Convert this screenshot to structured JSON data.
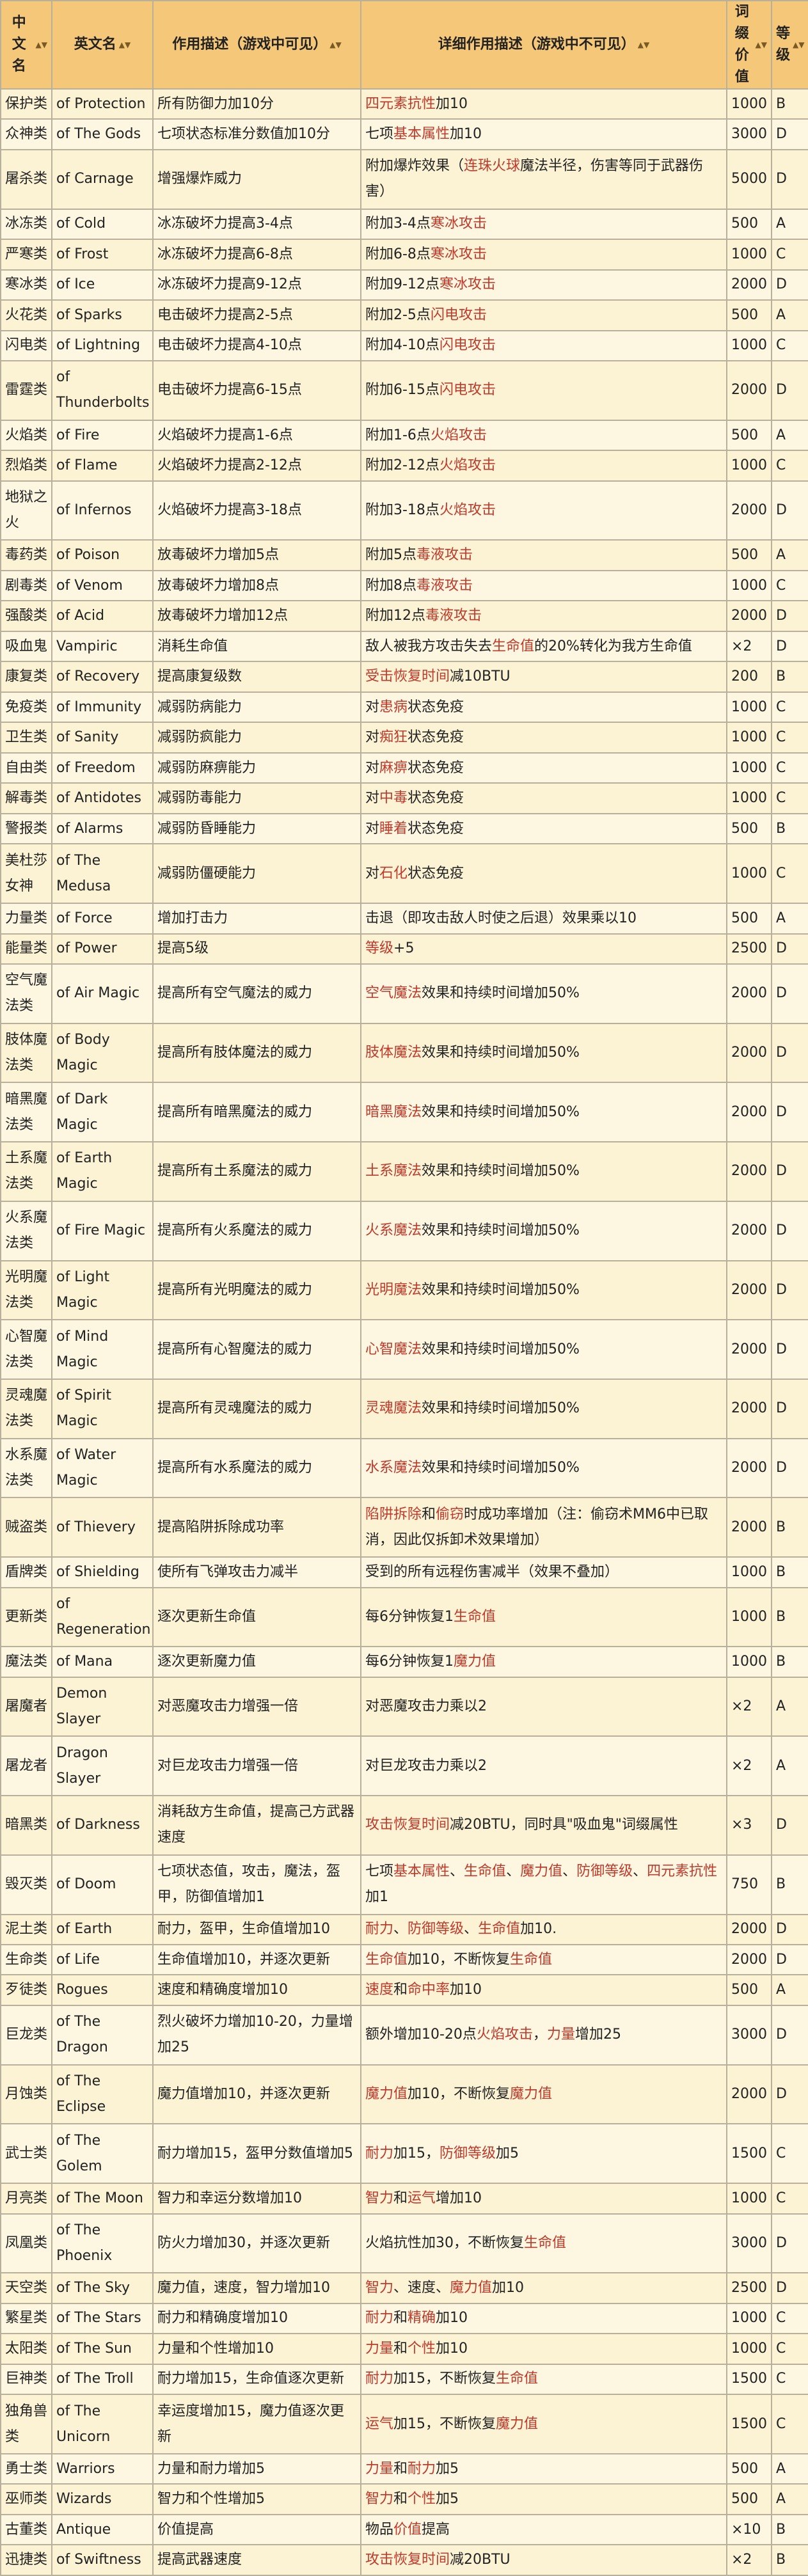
{
  "headers": {
    "cn": "中文名",
    "en": "英文名",
    "use": "作用描述（游戏中可见）",
    "detail": "详细作用描述（游戏中不可见）",
    "value": "词缀价值",
    "level": "等级"
  },
  "rows": [
    {
      "cn": "保护类",
      "en": "of Protection",
      "use": "所有防御力加10分",
      "detail": [
        [
          "四元素抗性",
          1
        ],
        [
          "加10",
          0
        ]
      ],
      "value": "1000",
      "level": "B"
    },
    {
      "cn": "众神类",
      "en": "of The Gods",
      "use": "七项状态标准分数值加10分",
      "detail": [
        [
          "七项",
          0
        ],
        [
          "基本属性",
          1
        ],
        [
          "加10",
          0
        ]
      ],
      "value": "3000",
      "level": "D"
    },
    {
      "cn": "屠杀类",
      "en": "of Carnage",
      "use": "增强爆炸威力",
      "detail": [
        [
          "附加爆炸效果（",
          0
        ],
        [
          "连珠火球",
          1
        ],
        [
          "魔法半径，伤害等同于武器伤害）",
          0
        ]
      ],
      "value": "5000",
      "level": "D"
    },
    {
      "cn": "冰冻类",
      "en": "of Cold",
      "use": "冰冻破坏力提高3-4点",
      "detail": [
        [
          "附加3-4点",
          0
        ],
        [
          "寒冰攻击",
          1
        ]
      ],
      "value": "500",
      "level": "A"
    },
    {
      "cn": "严寒类",
      "en": "of Frost",
      "use": "冰冻破坏力提高6-8点",
      "detail": [
        [
          "附加6-8点",
          0
        ],
        [
          "寒冰攻击",
          1
        ]
      ],
      "value": "1000",
      "level": "C"
    },
    {
      "cn": "寒冰类",
      "en": "of Ice",
      "use": "冰冻破坏力提高9-12点",
      "detail": [
        [
          "附加9-12点",
          0
        ],
        [
          "寒冰攻击",
          1
        ]
      ],
      "value": "2000",
      "level": "D"
    },
    {
      "cn": "火花类",
      "en": "of Sparks",
      "use": "电击破坏力提高2-5点",
      "detail": [
        [
          "附加2-5点",
          0
        ],
        [
          "闪电攻击",
          1
        ]
      ],
      "value": "500",
      "level": "A"
    },
    {
      "cn": "闪电类",
      "en": "of Lightning",
      "use": "电击破坏力提高4-10点",
      "detail": [
        [
          "附加4-10点",
          0
        ],
        [
          "闪电攻击",
          1
        ]
      ],
      "value": "1000",
      "level": "C"
    },
    {
      "cn": "雷霆类",
      "en": "of Thunderbolts",
      "use": "电击破坏力提高6-15点",
      "detail": [
        [
          "附加6-15点",
          0
        ],
        [
          "闪电攻击",
          1
        ]
      ],
      "value": "2000",
      "level": "D"
    },
    {
      "cn": "火焰类",
      "en": "of Fire",
      "use": "火焰破坏力提高1-6点",
      "detail": [
        [
          "附加1-6点",
          0
        ],
        [
          "火焰攻击",
          1
        ]
      ],
      "value": "500",
      "level": "A"
    },
    {
      "cn": "烈焰类",
      "en": "of Flame",
      "use": "火焰破坏力提高2-12点",
      "detail": [
        [
          "附加2-12点",
          0
        ],
        [
          "火焰攻击",
          1
        ]
      ],
      "value": "1000",
      "level": "C"
    },
    {
      "cn": "地狱之火",
      "en": "of Infernos",
      "use": "火焰破坏力提高3-18点",
      "detail": [
        [
          "附加3-18点",
          0
        ],
        [
          "火焰攻击",
          1
        ]
      ],
      "value": "2000",
      "level": "D"
    },
    {
      "cn": "毒药类",
      "en": "of Poison",
      "use": "放毒破坏力增加5点",
      "detail": [
        [
          "附加5点",
          0
        ],
        [
          "毒液攻击",
          1
        ]
      ],
      "value": "500",
      "level": "A"
    },
    {
      "cn": "剧毒类",
      "en": "of Venom",
      "use": "放毒破坏力增加8点",
      "detail": [
        [
          "附加8点",
          0
        ],
        [
          "毒液攻击",
          1
        ]
      ],
      "value": "1000",
      "level": "C"
    },
    {
      "cn": "强酸类",
      "en": "of Acid",
      "use": "放毒破坏力增加12点",
      "detail": [
        [
          "附加12点",
          0
        ],
        [
          "毒液攻击",
          1
        ]
      ],
      "value": "2000",
      "level": "D"
    },
    {
      "cn": "吸血鬼",
      "en": "Vampiric",
      "use": "消耗生命值",
      "detail": [
        [
          "敌人被我方攻击失去",
          0
        ],
        [
          "生命值",
          1
        ],
        [
          "的20%转化为我方生命值",
          0
        ]
      ],
      "value": "×2",
      "level": "D"
    },
    {
      "cn": "康复类",
      "en": "of Recovery",
      "use": "提高康复级数",
      "detail": [
        [
          "受击恢复时间",
          1
        ],
        [
          "减10BTU",
          0
        ]
      ],
      "value": "200",
      "level": "B"
    },
    {
      "cn": "免疫类",
      "en": "of Immunity",
      "use": "减弱防病能力",
      "detail": [
        [
          "对",
          0
        ],
        [
          "患病",
          1
        ],
        [
          "状态免疫",
          0
        ]
      ],
      "value": "1000",
      "level": "C"
    },
    {
      "cn": "卫生类",
      "en": "of Sanity",
      "use": "减弱防疯能力",
      "detail": [
        [
          "对",
          0
        ],
        [
          "痴狂",
          1
        ],
        [
          "状态免疫",
          0
        ]
      ],
      "value": "1000",
      "level": "C"
    },
    {
      "cn": "自由类",
      "en": "of Freedom",
      "use": "减弱防麻痹能力",
      "detail": [
        [
          "对",
          0
        ],
        [
          "麻痹",
          1
        ],
        [
          "状态免疫",
          0
        ]
      ],
      "value": "1000",
      "level": "C"
    },
    {
      "cn": "解毒类",
      "en": "of Antidotes",
      "use": "减弱防毒能力",
      "detail": [
        [
          "对",
          0
        ],
        [
          "中毒",
          1
        ],
        [
          "状态免疫",
          0
        ]
      ],
      "value": "1000",
      "level": "C"
    },
    {
      "cn": "警报类",
      "en": "of Alarms",
      "use": "减弱防昏睡能力",
      "detail": [
        [
          "对",
          0
        ],
        [
          "睡着",
          1
        ],
        [
          "状态免疫",
          0
        ]
      ],
      "value": "500",
      "level": "B"
    },
    {
      "cn": "美杜莎女神",
      "en": "of The Medusa",
      "use": "减弱防僵硬能力",
      "detail": [
        [
          "对",
          0
        ],
        [
          "石化",
          1
        ],
        [
          "状态免疫",
          0
        ]
      ],
      "value": "1000",
      "level": "C"
    },
    {
      "cn": "力量类",
      "en": "of Force",
      "use": "增加打击力",
      "detail": [
        [
          "击退（即攻击敌人时使之后退）效果乘以10",
          0
        ]
      ],
      "value": "500",
      "level": "A"
    },
    {
      "cn": "能量类",
      "en": "of Power",
      "use": "提高5级",
      "detail": [
        [
          "等级",
          1
        ],
        [
          "+5",
          0
        ]
      ],
      "value": "2500",
      "level": "D"
    },
    {
      "cn": "空气魔法类",
      "en": "of Air Magic",
      "use": "提高所有空气魔法的威力",
      "detail": [
        [
          "空气魔法",
          1
        ],
        [
          "效果和持续时间增加50%",
          0
        ]
      ],
      "value": "2000",
      "level": "D"
    },
    {
      "cn": "肢体魔法类",
      "en": "of Body Magic",
      "use": "提高所有肢体魔法的威力",
      "detail": [
        [
          "肢体魔法",
          1
        ],
        [
          "效果和持续时间增加50%",
          0
        ]
      ],
      "value": "2000",
      "level": "D"
    },
    {
      "cn": "暗黑魔法类",
      "en": "of Dark Magic",
      "use": "提高所有暗黑魔法的威力",
      "detail": [
        [
          "暗黑魔法",
          1
        ],
        [
          "效果和持续时间增加50%",
          0
        ]
      ],
      "value": "2000",
      "level": "D"
    },
    {
      "cn": "土系魔法类",
      "en": "of Earth Magic",
      "use": "提高所有土系魔法的威力",
      "detail": [
        [
          "土系魔法",
          1
        ],
        [
          "效果和持续时间增加50%",
          0
        ]
      ],
      "value": "2000",
      "level": "D"
    },
    {
      "cn": "火系魔法类",
      "en": "of Fire Magic",
      "use": "提高所有火系魔法的威力",
      "detail": [
        [
          "火系魔法",
          1
        ],
        [
          "效果和持续时间增加50%",
          0
        ]
      ],
      "value": "2000",
      "level": "D"
    },
    {
      "cn": "光明魔法类",
      "en": "of Light Magic",
      "use": "提高所有光明魔法的威力",
      "detail": [
        [
          "光明魔法",
          1
        ],
        [
          "效果和持续时间增加50%",
          0
        ]
      ],
      "value": "2000",
      "level": "D"
    },
    {
      "cn": "心智魔法类",
      "en": "of Mind Magic",
      "use": "提高所有心智魔法的威力",
      "detail": [
        [
          "心智魔法",
          1
        ],
        [
          "效果和持续时间增加50%",
          0
        ]
      ],
      "value": "2000",
      "level": "D"
    },
    {
      "cn": "灵魂魔法类",
      "en": "of Spirit Magic",
      "use": "提高所有灵魂魔法的威力",
      "detail": [
        [
          "灵魂魔法",
          1
        ],
        [
          "效果和持续时间增加50%",
          0
        ]
      ],
      "value": "2000",
      "level": "D"
    },
    {
      "cn": "水系魔法类",
      "en": "of Water Magic",
      "use": "提高所有水系魔法的威力",
      "detail": [
        [
          "水系魔法",
          1
        ],
        [
          "效果和持续时间增加50%",
          0
        ]
      ],
      "value": "2000",
      "level": "D"
    },
    {
      "cn": "贼盗类",
      "en": "of Thievery",
      "use": "提高陷阱拆除成功率",
      "detail": [
        [
          "陷阱拆除",
          1
        ],
        [
          "和",
          0
        ],
        [
          "偷窃",
          1
        ],
        [
          "时成功率增加（注：偷窃术MM6中已取消，因此仅拆卸术效果增加）",
          0
        ]
      ],
      "value": "2000",
      "level": "B"
    },
    {
      "cn": "盾牌类",
      "en": "of Shielding",
      "use": "使所有飞弹攻击力减半",
      "detail": [
        [
          "受到的所有远程伤害减半（效果不叠加）",
          0
        ]
      ],
      "value": "1000",
      "level": "B"
    },
    {
      "cn": "更新类",
      "en": "of Regeneration",
      "use": "逐次更新生命值",
      "detail": [
        [
          "每6分钟恢复1",
          0
        ],
        [
          "生命值",
          1
        ]
      ],
      "value": "1000",
      "level": "B"
    },
    {
      "cn": "魔法类",
      "en": "of Mana",
      "use": "逐次更新魔力值",
      "detail": [
        [
          "每6分钟恢复1",
          0
        ],
        [
          "魔力值",
          1
        ]
      ],
      "value": "1000",
      "level": "B"
    },
    {
      "cn": "屠魔者",
      "en": "Demon Slayer",
      "use": "对恶魔攻击力增强一倍",
      "detail": [
        [
          "对恶魔攻击力乘以2",
          0
        ]
      ],
      "value": "×2",
      "level": "A"
    },
    {
      "cn": "屠龙者",
      "en": "Dragon Slayer",
      "use": "对巨龙攻击力增强一倍",
      "detail": [
        [
          "对巨龙攻击力乘以2",
          0
        ]
      ],
      "value": "×2",
      "level": "A"
    },
    {
      "cn": "暗黑类",
      "en": "of Darkness",
      "use": "消耗敌方生命值，提高己方武器速度",
      "detail": [
        [
          "攻击恢复时间",
          1
        ],
        [
          "减20BTU，同时具\"吸血鬼\"词缀属性",
          0
        ]
      ],
      "value": "×3",
      "level": "D"
    },
    {
      "cn": "毁灭类",
      "en": "of Doom",
      "use": "七项状态值，攻击，魔法，盔甲，防御值增加1",
      "detail": [
        [
          "七项",
          0
        ],
        [
          "基本属性",
          1
        ],
        [
          "、",
          0
        ],
        [
          "生命值",
          1
        ],
        [
          "、",
          0
        ],
        [
          "魔力值",
          1
        ],
        [
          "、",
          0
        ],
        [
          "防御等级",
          1
        ],
        [
          "、",
          0
        ],
        [
          "四元素抗性",
          1
        ],
        [
          "加1",
          0
        ]
      ],
      "value": "750",
      "level": "B"
    },
    {
      "cn": "泥土类",
      "en": "of Earth",
      "use": "耐力，盔甲，生命值增加10",
      "detail": [
        [
          "耐力",
          1
        ],
        [
          "、",
          0
        ],
        [
          "防御等级",
          1
        ],
        [
          "、",
          0
        ],
        [
          "生命值",
          1
        ],
        [
          "加10.",
          0
        ]
      ],
      "value": "2000",
      "level": "D"
    },
    {
      "cn": "生命类",
      "en": "of Life",
      "use": "生命值增加10，并逐次更新",
      "detail": [
        [
          "生命值",
          1
        ],
        [
          "加10，不断恢复",
          0
        ],
        [
          "生命值",
          1
        ]
      ],
      "value": "2000",
      "level": "D"
    },
    {
      "cn": "歹徒类",
      "en": "Rogues",
      "use": "速度和精确度增加10",
      "detail": [
        [
          "速度",
          1
        ],
        [
          "和",
          0
        ],
        [
          "命中率",
          1
        ],
        [
          "加10",
          0
        ]
      ],
      "value": "500",
      "level": "A"
    },
    {
      "cn": "巨龙类",
      "en": "of The Dragon",
      "use": "烈火破坏力增加10-20，力量增加25",
      "detail": [
        [
          "额外增加10-20点",
          0
        ],
        [
          "火焰攻击",
          1
        ],
        [
          "，",
          0
        ],
        [
          "力量",
          1
        ],
        [
          "增加25",
          0
        ]
      ],
      "value": "3000",
      "level": "D"
    },
    {
      "cn": "月蚀类",
      "en": "of The Eclipse",
      "use": "魔力值增加10，并逐次更新",
      "detail": [
        [
          "魔力值",
          1
        ],
        [
          "加10，不断恢复",
          0
        ],
        [
          "魔力值",
          1
        ]
      ],
      "value": "2000",
      "level": "D"
    },
    {
      "cn": "武士类",
      "en": "of The Golem",
      "use": "耐力增加15，盔甲分数值增加5",
      "detail": [
        [
          "耐力",
          1
        ],
        [
          "加15，",
          0
        ],
        [
          "防御等级",
          1
        ],
        [
          "加5",
          0
        ]
      ],
      "value": "1500",
      "level": "C"
    },
    {
      "cn": "月亮类",
      "en": "of The Moon",
      "use": "智力和幸运分数增加10",
      "detail": [
        [
          "智力",
          1
        ],
        [
          "和",
          0
        ],
        [
          "运气",
          1
        ],
        [
          "增加10",
          0
        ]
      ],
      "value": "1000",
      "level": "C"
    },
    {
      "cn": "凤凰类",
      "en": "of The Phoenix",
      "use": "防火力增加30，并逐次更新",
      "detail": [
        [
          "火焰抗性加30，不断恢复",
          0
        ],
        [
          "生命值",
          1
        ]
      ],
      "value": "3000",
      "level": "D"
    },
    {
      "cn": "天空类",
      "en": "of The Sky",
      "use": "魔力值，速度，智力增加10",
      "detail": [
        [
          "智力",
          1
        ],
        [
          "、速度、",
          0
        ],
        [
          "魔力值",
          1
        ],
        [
          "加10",
          0
        ]
      ],
      "value": "2500",
      "level": "D"
    },
    {
      "cn": "繁星类",
      "en": "of The Stars",
      "use": "耐力和精确度增加10",
      "detail": [
        [
          "耐力",
          1
        ],
        [
          "和",
          0
        ],
        [
          "精确",
          1
        ],
        [
          "加10",
          0
        ]
      ],
      "value": "1000",
      "level": "C"
    },
    {
      "cn": "太阳类",
      "en": "of The Sun",
      "use": "力量和个性增加10",
      "detail": [
        [
          "力量",
          1
        ],
        [
          "和",
          0
        ],
        [
          "个性",
          1
        ],
        [
          "加10",
          0
        ]
      ],
      "value": "1000",
      "level": "C"
    },
    {
      "cn": "巨神类",
      "en": "of The Troll",
      "use": "耐力增加15，生命值逐次更新",
      "detail": [
        [
          "耐力",
          1
        ],
        [
          "加15，不断恢复",
          0
        ],
        [
          "生命值",
          1
        ]
      ],
      "value": "1500",
      "level": "C"
    },
    {
      "cn": "独角兽类",
      "en": "of The Unicorn",
      "use": "幸运度增加15，魔力值逐次更新",
      "detail": [
        [
          "运气",
          1
        ],
        [
          "加15，不断恢复",
          0
        ],
        [
          "魔力值",
          1
        ]
      ],
      "value": "1500",
      "level": "C"
    },
    {
      "cn": "勇士类",
      "en": "Warriors",
      "use": "力量和耐力增加5",
      "detail": [
        [
          "力量",
          1
        ],
        [
          "和",
          0
        ],
        [
          "耐力",
          1
        ],
        [
          "加5",
          0
        ]
      ],
      "value": "500",
      "level": "A"
    },
    {
      "cn": "巫师类",
      "en": "Wizards",
      "use": "智力和个性增加5",
      "detail": [
        [
          "智力",
          1
        ],
        [
          "和",
          0
        ],
        [
          "个性",
          1
        ],
        [
          "加5",
          0
        ]
      ],
      "value": "500",
      "level": "A"
    },
    {
      "cn": "古董类",
      "en": "Antique",
      "use": "价值提高",
      "detail": [
        [
          "物品",
          0
        ],
        [
          "价值",
          1
        ],
        [
          "提高",
          0
        ]
      ],
      "value": "×10",
      "level": "B"
    },
    {
      "cn": "迅捷类",
      "en": "of Swiftness",
      "use": "提高武器速度",
      "detail": [
        [
          "攻击恢复时间",
          1
        ],
        [
          "减20BTU",
          0
        ]
      ],
      "value": "×2",
      "level": "B"
    }
  ]
}
